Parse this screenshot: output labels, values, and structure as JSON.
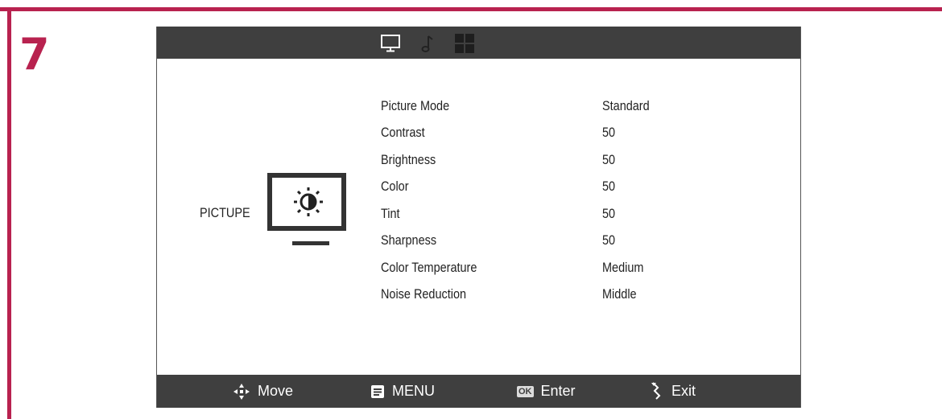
{
  "step_number": "7",
  "osd": {
    "tabs": [
      {
        "icon": "monitor-icon",
        "active": true
      },
      {
        "icon": "music-note-icon",
        "active": false
      },
      {
        "icon": "grid-icon",
        "active": false
      }
    ],
    "section_label": "PICTUPE",
    "section_icon": "brightness-contrast-icon",
    "menu_items": [
      {
        "label": "Picture Mode",
        "value": "Standard"
      },
      {
        "label": "Contrast",
        "value": "50"
      },
      {
        "label": "Brightness",
        "value": "50"
      },
      {
        "label": "Color",
        "value": "50"
      },
      {
        "label": "Tint",
        "value": "50"
      },
      {
        "label": "Sharpness",
        "value": "50"
      },
      {
        "label": "Color Temperature",
        "value": "Medium"
      },
      {
        "label": "Noise Reduction",
        "value": "Middle"
      }
    ],
    "hints": {
      "move": "Move",
      "menu": "MENU",
      "ok_badge": "OK",
      "enter": "Enter",
      "exit": "Exit"
    }
  },
  "colors": {
    "accent": "#b8224f",
    "bar": "#3f3f3f"
  }
}
